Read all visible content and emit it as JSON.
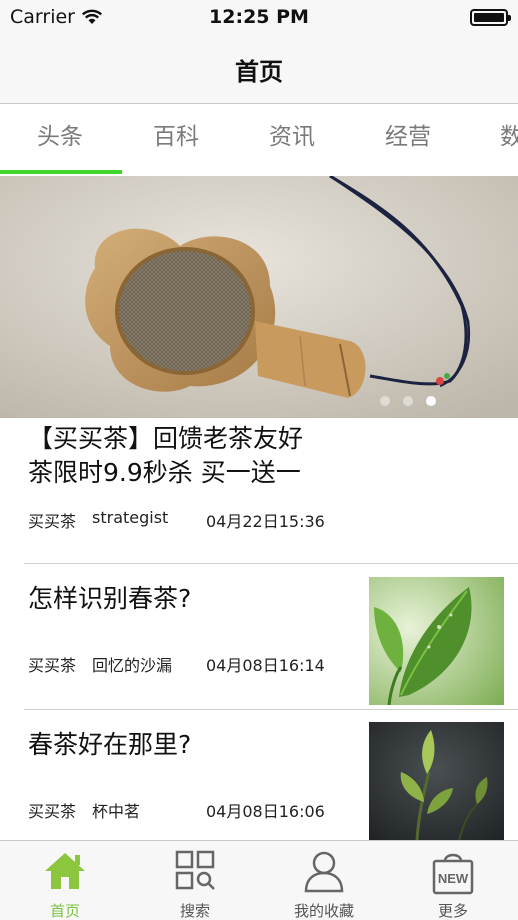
{
  "status_bar": {
    "carrier": "Carrier",
    "time": "12:25 PM"
  },
  "nav": {
    "title": "首页"
  },
  "tabs": [
    {
      "label": "头条"
    },
    {
      "label": "百科"
    },
    {
      "label": "资讯"
    },
    {
      "label": "经营"
    },
    {
      "label": "数"
    }
  ],
  "banner": {
    "slide_count": 3,
    "active_slide": 3
  },
  "articles": [
    {
      "title_line1": "【买买茶】回馈老茶友好",
      "title_line2": "茶限时9.9秒杀 买一送一",
      "source": "买买茶",
      "author": "strategist",
      "date": "04月22日15:36"
    },
    {
      "title": "怎样识别春茶?",
      "source": "买买茶",
      "author": "回忆的沙漏",
      "date": "04月08日16:14"
    },
    {
      "title": "春茶好在那里?",
      "source": "买买茶",
      "author": "杯中茗",
      "date": "04月08日16:06"
    }
  ],
  "tab_bar": {
    "home": "首页",
    "search": "搜索",
    "favorites": "我的收藏",
    "more": "更多",
    "new_badge": "NEW"
  },
  "colors": {
    "accent_green": "#41d62c",
    "tab_active": "#7cc242"
  }
}
